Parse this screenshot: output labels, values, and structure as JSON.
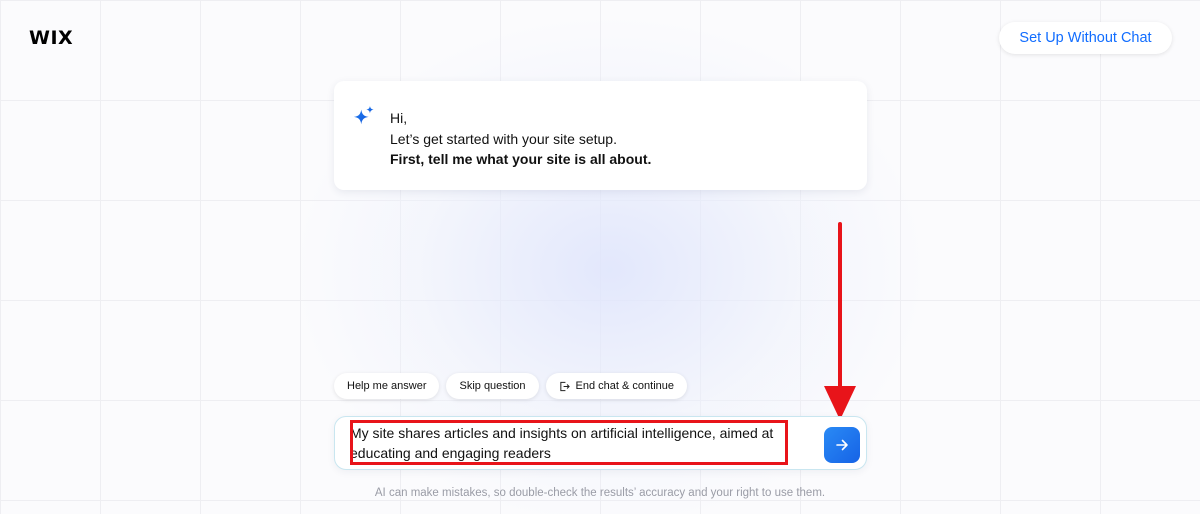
{
  "header": {
    "logo": "WIX",
    "setup_button": "Set Up Without Chat"
  },
  "message": {
    "line1": "Hi,",
    "line2": "Let’s get started with your site setup.",
    "line3": "First, tell me what your site is all about.",
    "icon": "sparkle-icon"
  },
  "chips": {
    "help": "Help me answer",
    "skip": "Skip question",
    "end": "End chat & continue",
    "end_icon": "exit-icon"
  },
  "input": {
    "value": "My site shares articles and insights on artificial intelligence, aimed at educating and engaging readers",
    "send_icon": "arrow-right-icon"
  },
  "disclaimer": "AI can make mistakes, so double-check the results’ accuracy and your right to use them.",
  "colors": {
    "accent": "#116dff",
    "annotation": "#e8141a"
  }
}
